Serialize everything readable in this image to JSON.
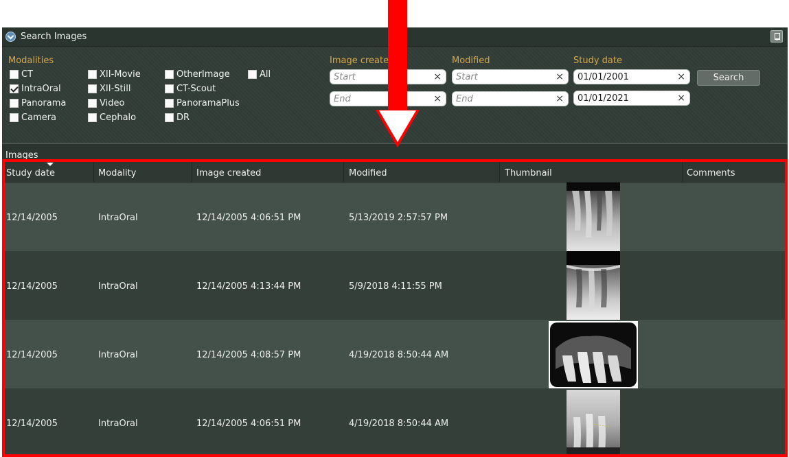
{
  "search": {
    "title": "Search Images",
    "modalities_label": "Modalities",
    "modalities": [
      {
        "label": "CT",
        "checked": false
      },
      {
        "label": "XII-Movie",
        "checked": false
      },
      {
        "label": "OtherImage",
        "checked": false
      },
      {
        "label": "All",
        "checked": false
      },
      {
        "label": "IntraOral",
        "checked": true
      },
      {
        "label": "XII-Still",
        "checked": false
      },
      {
        "label": "CT-Scout",
        "checked": false
      },
      {
        "label": "Panorama",
        "checked": false
      },
      {
        "label": "Video",
        "checked": false
      },
      {
        "label": "PanoramaPlus",
        "checked": false
      },
      {
        "label": "Camera",
        "checked": false
      },
      {
        "label": "Cephalo",
        "checked": false
      },
      {
        "label": "DR",
        "checked": false
      }
    ],
    "image_created": {
      "label": "Image create",
      "start_placeholder": "Start",
      "end_placeholder": "End"
    },
    "modified": {
      "label": "Modified",
      "start_placeholder": "Start",
      "end_placeholder": "End"
    },
    "study_date": {
      "label": "Study date",
      "start_value": "01/01/2001",
      "end_value": "01/01/2021"
    },
    "clear_glyph": "×",
    "search_button": "Search"
  },
  "images": {
    "caption": "Images",
    "columns": [
      "Study date",
      "Modality",
      "Image created",
      "Modified",
      "Thumbnail",
      "Comments"
    ],
    "rows": [
      {
        "study_date": "12/14/2005",
        "modality": "IntraOral",
        "image_created": "12/14/2005 4:06:51 PM",
        "modified": "5/13/2019 2:57:57 PM",
        "comments": ""
      },
      {
        "study_date": "12/14/2005",
        "modality": "IntraOral",
        "image_created": "12/14/2005 4:13:44 PM",
        "modified": "5/9/2018 4:11:55 PM",
        "comments": ""
      },
      {
        "study_date": "12/14/2005",
        "modality": "IntraOral",
        "image_created": "12/14/2005 4:08:57 PM",
        "modified": "4/19/2018 8:50:44 AM",
        "comments": ""
      },
      {
        "study_date": "12/14/2005",
        "modality": "IntraOral",
        "image_created": "12/14/2005 4:06:51 PM",
        "modified": "4/19/2018 8:50:44 AM",
        "comments": ""
      }
    ]
  },
  "colors": {
    "annotation": "#ff0000",
    "label_accent": "#d7a84a",
    "panel_bg": "#323d37"
  }
}
